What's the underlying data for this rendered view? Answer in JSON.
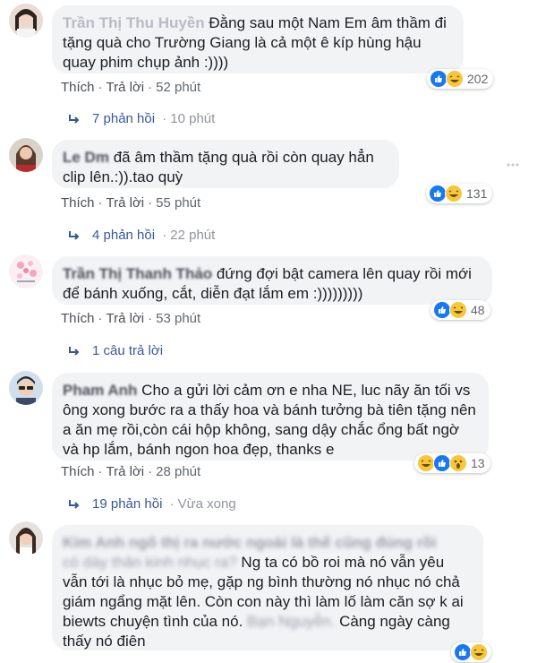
{
  "labels": {
    "like": "Thích",
    "reply": "Trả lời",
    "dot": "·"
  },
  "comments": [
    {
      "name": "Trần Thị Thu Huyền",
      "text": "Đằng sau một Nam Em âm thầm đi tặng quà cho Trường Giang là cả một ê kíp hùng hậu quay phim chụp ảnh :))))",
      "time": "52 phút",
      "reactions": [
        "like",
        "haha"
      ],
      "reaction_count": "202",
      "replies": "7 phản hồi",
      "replies_time": "10 phút"
    },
    {
      "name": "Le Dm",
      "text": "đã âm thầm tặng quà rồi còn quay hẳn clip lên.:)).tao quỳ",
      "time": "55 phút",
      "reactions": [
        "like",
        "haha"
      ],
      "reaction_count": "131",
      "replies": "4 phản hồi",
      "replies_time": "22 phút"
    },
    {
      "name": "Trần Thị Thanh Thảo",
      "text": "đứng đợi bật camera lên quay rồi mới để bánh xuống, cắt, diễn đạt lắm em :)))))))))",
      "time": "53 phút",
      "reactions": [
        "like",
        "haha"
      ],
      "reaction_count": "48",
      "replies": "1 câu trả lời",
      "replies_time": ""
    },
    {
      "name": "Pham Anh",
      "text": "Cho a gửi lời cảm ơn e nha NE, luc nãy ăn tối vs ông xong bước ra a thấy hoa và bánh tưởng bà tiên tặng nên a ăn mẹ rồi,còn cái hộp không, sang dậy chắc ổng bất ngờ và hp lắm, bánh ngon hoa đẹp, thanks e",
      "time": "28 phút",
      "reactions": [
        "haha",
        "like",
        "wow"
      ],
      "reaction_count": "13",
      "replies": "19 phản hồi",
      "replies_time": "Vừa xong"
    },
    {
      "text_a": "có dày thân kinh nhục ra?",
      "text_b": "Ng ta có bồ roi mà nó vẫn yêu vẫn tới là nhục bỏ mẹ, gặp ng bình thường nó nhục nó chả giám ngẩng mặt lên. Còn con này thì làm lố làm căn sợ k ai biewts chuyện tình của nó.",
      "text_c": "Càng ngày càng thấy nó điên"
    }
  ]
}
